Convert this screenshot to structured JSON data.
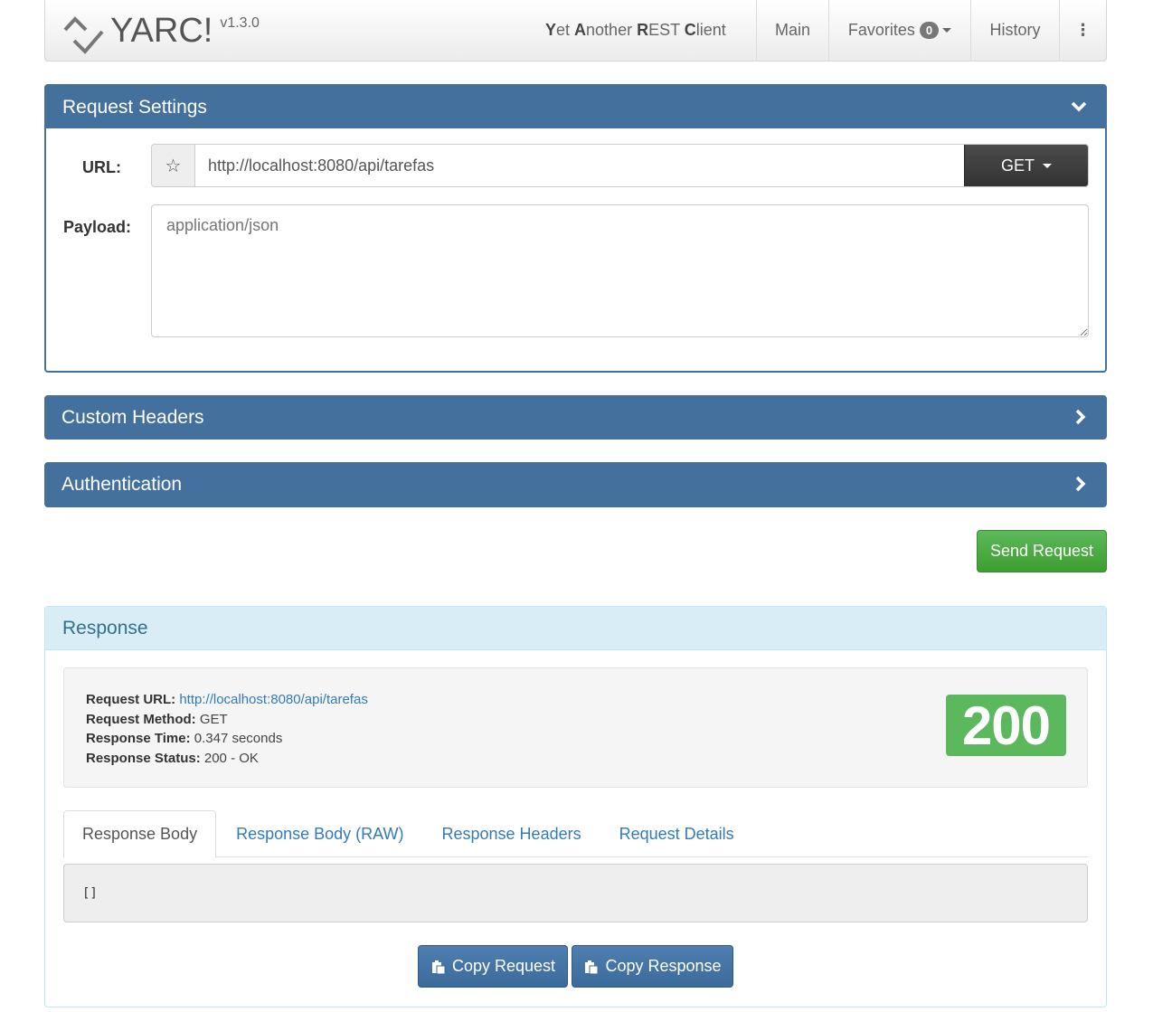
{
  "navbar": {
    "brand_name": "YARC!",
    "version": "v1.3.0",
    "tagline_parts": [
      {
        "bold": "Y",
        "rest": "et "
      },
      {
        "bold": "A",
        "rest": "nother "
      },
      {
        "bold": "R",
        "rest": "EST "
      },
      {
        "bold": "C",
        "rest": "lient"
      }
    ],
    "main_label": "Main",
    "favorites_label": "Favorites",
    "favorites_count": "0",
    "history_label": "History",
    "more_label": "⋮"
  },
  "request_settings": {
    "title": "Request Settings",
    "url_label": "URL:",
    "url_value": "http://localhost:8080/api/tarefas",
    "method": "GET",
    "payload_label": "Payload:",
    "payload_placeholder": "application/json"
  },
  "custom_headers": {
    "title": "Custom Headers"
  },
  "authentication": {
    "title": "Authentication"
  },
  "send_button": "Send Request",
  "response": {
    "title": "Response",
    "request_url_label": "Request URL:",
    "request_url": "http://localhost:8080/api/tarefas",
    "request_method_label": "Request Method:",
    "request_method": "GET",
    "response_time_label": "Response Time:",
    "response_time": "0.347 seconds",
    "response_status_label": "Response Status:",
    "response_status": "200 - OK",
    "status_code": "200",
    "tabs": [
      "Response Body",
      "Response Body (RAW)",
      "Response Headers",
      "Request Details"
    ],
    "body": "[]",
    "copy_request": "Copy Request",
    "copy_response": "Copy Response"
  },
  "colors": {
    "primary": "#44709e",
    "success": "#5cb85c",
    "info_bg": "#d9edf7",
    "link": "#337ab7"
  }
}
